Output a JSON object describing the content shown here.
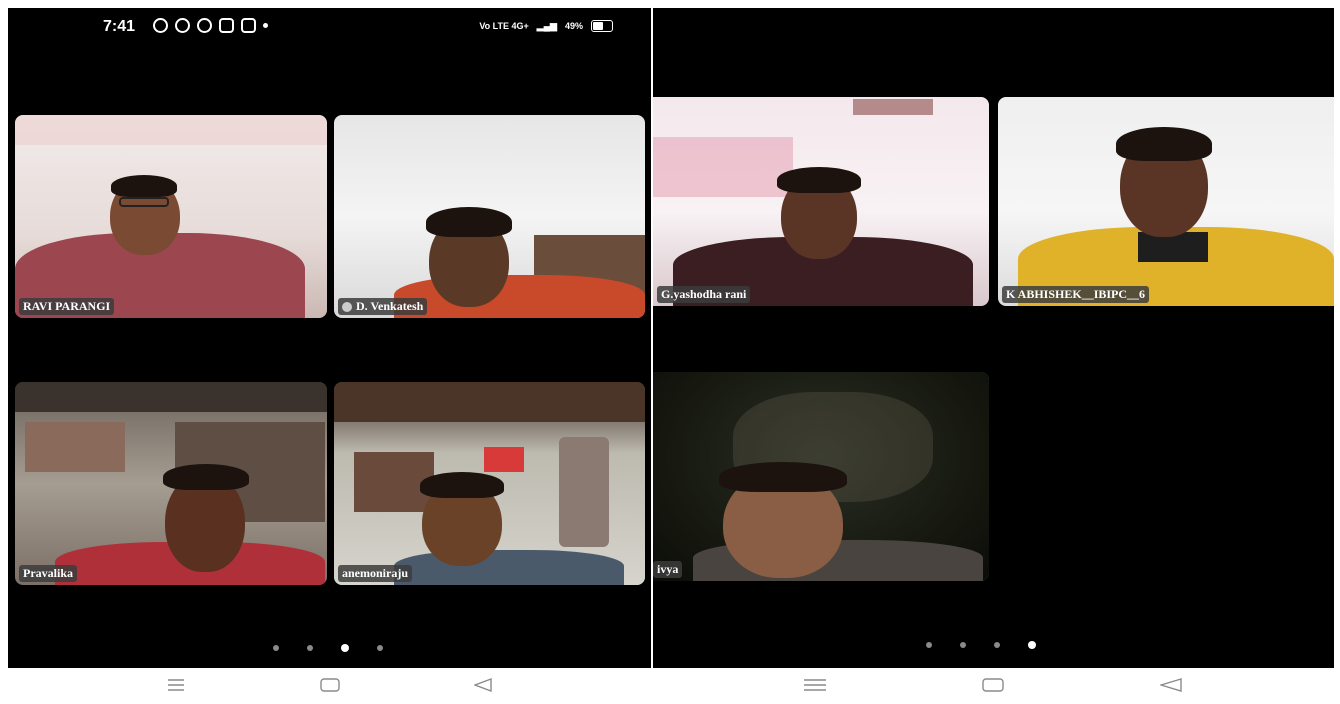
{
  "status_bar": {
    "time": "7:41",
    "signal_text": "Vo LTE 4G+",
    "battery": "49%",
    "battery_level": 0.49
  },
  "left": {
    "participants": [
      {
        "name": "RAVI PARANGI",
        "active": false
      },
      {
        "name": "D. Venkatesh",
        "active": false
      },
      {
        "name": "Pravalika",
        "active": false
      },
      {
        "name": "anemoniraju",
        "active": true
      }
    ],
    "page_dots": {
      "count": 4,
      "current": 3
    }
  },
  "right": {
    "participants": [
      {
        "name": "G.yashodha rani",
        "active": false
      },
      {
        "name": "K ABHISHEK__IBIPC__6",
        "active": false
      },
      {
        "name": "ivya",
        "active": true
      }
    ],
    "page_dots": {
      "count": 4,
      "current": 4
    }
  },
  "nav_bar": {
    "buttons": [
      "menu-icon",
      "home-icon",
      "back-icon"
    ]
  },
  "colors": {
    "active_border": "#3ec26b",
    "screen_bg": "#000000"
  }
}
